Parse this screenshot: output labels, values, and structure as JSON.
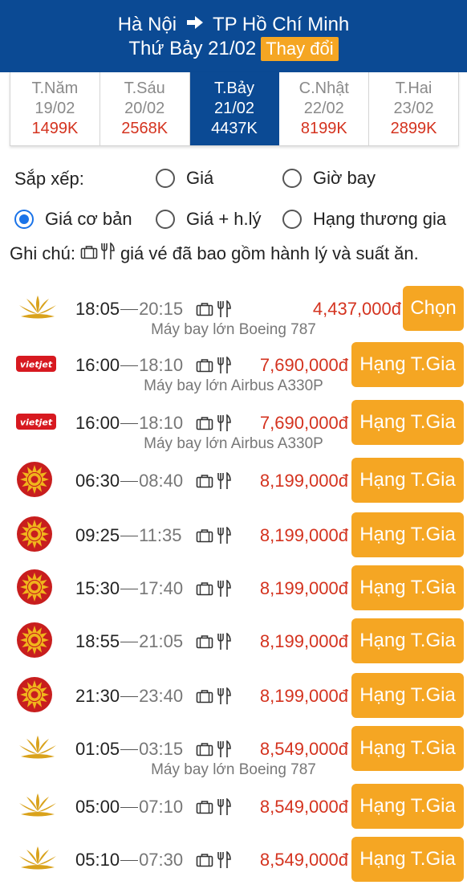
{
  "header": {
    "origin": "Hà Nội",
    "destination": "TP Hồ Chí Minh",
    "date_text": "Thứ Bảy 21/02",
    "change_label": "Thay đổi"
  },
  "dates": [
    {
      "day": "T.Năm",
      "date": "19/02",
      "price": "1499K",
      "active": false
    },
    {
      "day": "T.Sáu",
      "date": "20/02",
      "price": "2568K",
      "active": false
    },
    {
      "day": "T.Bảy",
      "date": "21/02",
      "price": "4437K",
      "active": true
    },
    {
      "day": "C.Nhật",
      "date": "22/02",
      "price": "8199K",
      "active": false
    },
    {
      "day": "T.Hai",
      "date": "23/02",
      "price": "2899K",
      "active": false
    }
  ],
  "sort": {
    "label": "Sắp xếp:",
    "options": [
      {
        "label": "Giá",
        "selected": false
      },
      {
        "label": "Giờ bay",
        "selected": false
      },
      {
        "label": "Giá cơ bản",
        "selected": true
      },
      {
        "label": "Giá + h.lý",
        "selected": false
      },
      {
        "label": "Hạng thương gia",
        "selected": false
      }
    ]
  },
  "note": {
    "label": "Ghi chú:",
    "text": "giá vé đã bao gồm hành lý và suất ăn."
  },
  "flights": [
    {
      "airline_logo": "lotus-logo",
      "depart": "18:05",
      "arrive": "20:15",
      "price": "4,437,000đ",
      "button": "Chọn",
      "aircraft": "Máy bay lớn Boeing 787"
    },
    {
      "airline_logo": "vietjet-logo",
      "depart": "16:00",
      "arrive": "18:10",
      "price": "7,690,000đ",
      "button": "Hạng T.Gia",
      "aircraft": "Máy bay lớn Airbus A330P"
    },
    {
      "airline_logo": "vietjet-logo",
      "depart": "16:00",
      "arrive": "18:10",
      "price": "7,690,000đ",
      "button": "Hạng T.Gia",
      "aircraft": "Máy bay lớn Airbus A330P"
    },
    {
      "airline_logo": "sun-logo",
      "depart": "06:30",
      "arrive": "08:40",
      "price": "8,199,000đ",
      "button": "Hạng T.Gia",
      "aircraft": ""
    },
    {
      "airline_logo": "sun-logo",
      "depart": "09:25",
      "arrive": "11:35",
      "price": "8,199,000đ",
      "button": "Hạng T.Gia",
      "aircraft": ""
    },
    {
      "airline_logo": "sun-logo",
      "depart": "15:30",
      "arrive": "17:40",
      "price": "8,199,000đ",
      "button": "Hạng T.Gia",
      "aircraft": ""
    },
    {
      "airline_logo": "sun-logo",
      "depart": "18:55",
      "arrive": "21:05",
      "price": "8,199,000đ",
      "button": "Hạng T.Gia",
      "aircraft": ""
    },
    {
      "airline_logo": "sun-logo",
      "depart": "21:30",
      "arrive": "23:40",
      "price": "8,199,000đ",
      "button": "Hạng T.Gia",
      "aircraft": ""
    },
    {
      "airline_logo": "lotus-logo",
      "depart": "01:05",
      "arrive": "03:15",
      "price": "8,549,000đ",
      "button": "Hạng T.Gia",
      "aircraft": "Máy bay lớn Boeing 787"
    },
    {
      "airline_logo": "lotus-logo",
      "depart": "05:00",
      "arrive": "07:10",
      "price": "8,549,000đ",
      "button": "Hạng T.Gia",
      "aircraft": ""
    },
    {
      "airline_logo": "lotus-logo",
      "depart": "05:10",
      "arrive": "07:30",
      "price": "8,549,000đ",
      "button": "Hạng T.Gia",
      "aircraft": ""
    }
  ],
  "colors": {
    "header_bg": "#0b4a94",
    "accent_orange": "#f5a623",
    "price_red": "#d4331f",
    "radio_blue": "#1a73e8",
    "lotus_gold": "#d9a21b",
    "vietjet_red": "#d71920",
    "sun_red": "#c81e1e"
  }
}
